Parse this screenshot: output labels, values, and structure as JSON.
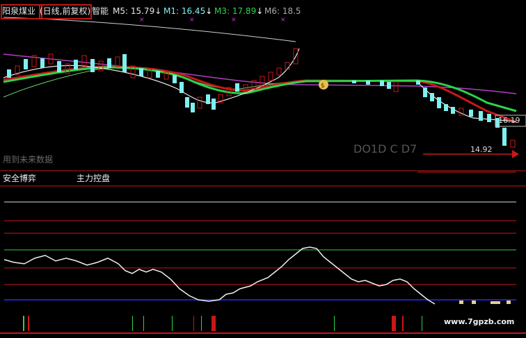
{
  "header": {
    "stock_name": "阳泉煤业",
    "period_label": "(日线,前复权)",
    "indicator_label": "智能",
    "ma_items": [
      {
        "label": "M5: 15.79",
        "arrow": "↓",
        "color": "#e6e6e6"
      },
      {
        "label": "M1: 16.45",
        "arrow": "↓",
        "color": "#ffffff"
      },
      {
        "label": "M3: 17.89",
        "arrow": "↓",
        "color": "#2cd34a"
      },
      {
        "label": "M6: 18.5",
        "arrow": "",
        "color": "#e0e0e0"
      }
    ]
  },
  "price_panel": {
    "price_right_label": "16.19",
    "low_label": "14.92",
    "watermark_text": "用到未来数据",
    "faded_text": "DO1D  C  D7"
  },
  "sub_panel": {
    "title_left": "安全博弈",
    "title_mid": "主力控盘"
  },
  "watermark_site": "www.7gpzb.com",
  "colors": {
    "background": "#000000",
    "red_line": "#c81818",
    "green_line": "#2cd34a",
    "purple_line": "#b040c0",
    "cyan_candle": "#7ff0f0",
    "blue_line": "#2b2bff"
  }
}
